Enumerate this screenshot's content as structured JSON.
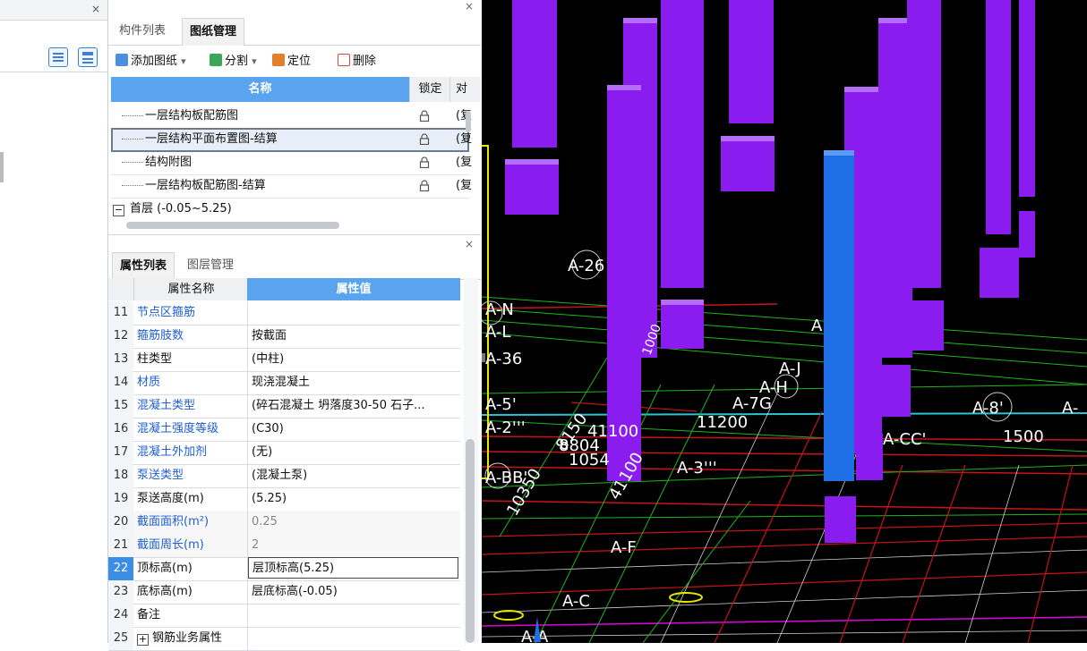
{
  "left_panel": {
    "close_glyph": "×",
    "view_buttons": [
      "list-view-icon",
      "detail-view-icon"
    ]
  },
  "drawing_panel": {
    "close_glyph": "×",
    "tabs": [
      {
        "label": "构件列表",
        "active": false
      },
      {
        "label": "图纸管理",
        "active": true
      }
    ],
    "toolbar": {
      "add": "添加图纸",
      "split": "分割",
      "locate": "定位",
      "delete": "删除",
      "dropdown_glyph": "▾"
    },
    "columns": {
      "name": "名称",
      "lock": "锁定",
      "compare": "对"
    },
    "rows": [
      {
        "label": "一层结构板配筋图",
        "compare": "(复"
      },
      {
        "label": "一层结构平面布置图-结算",
        "compare": "(复",
        "selected": true
      },
      {
        "label": "结构附图",
        "compare": "(复"
      },
      {
        "label": "一层结构板配筋图-结算",
        "compare": "(复"
      }
    ],
    "floor": {
      "toggle": "−",
      "label": "首层 (-0.05~5.25)"
    }
  },
  "property_panel": {
    "close_glyph": "×",
    "tabs": [
      {
        "label": "属性列表",
        "active": true
      },
      {
        "label": "图层管理",
        "active": false
      }
    ],
    "columns": {
      "name": "属性名称",
      "value": "属性值"
    },
    "rows": [
      {
        "idx": "11",
        "name": "节点区箍筋",
        "value": "",
        "blue": true
      },
      {
        "idx": "12",
        "name": "箍筋肢数",
        "value": "按截面",
        "blue": true
      },
      {
        "idx": "13",
        "name": "柱类型",
        "value": "(中柱)",
        "blue": false
      },
      {
        "idx": "14",
        "name": "材质",
        "value": "现浇混凝土",
        "blue": true
      },
      {
        "idx": "15",
        "name": "混凝土类型",
        "value": "(碎石混凝土 坍落度30-50 石子...",
        "blue": true
      },
      {
        "idx": "16",
        "name": "混凝土强度等级",
        "value": "(C30)",
        "blue": true
      },
      {
        "idx": "17",
        "name": "混凝土外加剂",
        "value": "(无)",
        "blue": true
      },
      {
        "idx": "18",
        "name": "泵送类型",
        "value": "(混凝土泵)",
        "blue": true
      },
      {
        "idx": "19",
        "name": "泵送高度(m)",
        "value": "(5.25)",
        "blue": false
      },
      {
        "idx": "20",
        "name": "截面面积(m²)",
        "value": "0.25",
        "blue": true,
        "grey": true
      },
      {
        "idx": "21",
        "name": "截面周长(m)",
        "value": "2",
        "blue": true,
        "grey": true
      },
      {
        "idx": "22",
        "name": "顶标高(m)",
        "value": "层顶标高(5.25)",
        "blue": false,
        "active": true
      },
      {
        "idx": "23",
        "name": "底标高(m)",
        "value": "层底标高(-0.05)",
        "blue": false
      },
      {
        "idx": "24",
        "name": "备注",
        "value": "",
        "blue": false
      },
      {
        "idx": "25",
        "name": "钢筋业务属性",
        "value": "",
        "blue": false,
        "expand": "+"
      }
    ]
  },
  "viewport": {
    "axis_labels": [
      "A-26",
      "A-N",
      "A-L",
      "A-36",
      "A-5'",
      "A-2'''",
      "A-BB'",
      "A-J",
      "A-H",
      "A-7G",
      "A-8'",
      "A-",
      "A-3'''",
      "A-CC'",
      "A-F",
      "A-C",
      "A-A",
      "A"
    ],
    "dimensions": [
      "11200",
      "1500",
      "8150",
      "41100",
      "8804",
      "1054",
      "10350",
      "41100",
      "1000"
    ],
    "colors": {
      "background": "#000000",
      "column_purple": "#8a1cf0",
      "column_selected": "#1f6fe6",
      "grid_green": "#1db51d",
      "grid_red": "#c8121b",
      "grid_cyan": "#29c4d4",
      "selection_yellow": "#e6e600"
    }
  }
}
